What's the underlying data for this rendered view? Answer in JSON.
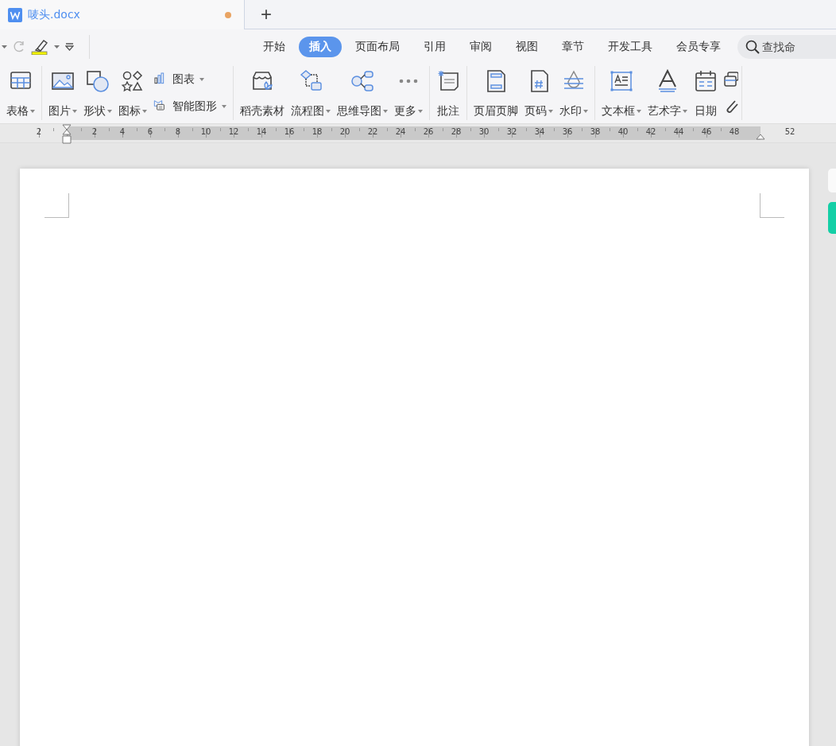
{
  "document_tab": {
    "title": "唛头.docx",
    "modified": true
  },
  "new_tab_button": "+",
  "menu_tabs": [
    {
      "label": "开始",
      "selected": false
    },
    {
      "label": "插入",
      "selected": true
    },
    {
      "label": "页面布局",
      "selected": false
    },
    {
      "label": "引用",
      "selected": false
    },
    {
      "label": "审阅",
      "selected": false
    },
    {
      "label": "视图",
      "selected": false
    },
    {
      "label": "章节",
      "selected": false
    },
    {
      "label": "开发工具",
      "selected": false
    },
    {
      "label": "会员专享",
      "selected": false
    }
  ],
  "search": {
    "placeholder": "查找命"
  },
  "ribbon_groups": [
    {
      "items": [
        {
          "kind": "large",
          "label": "表格",
          "dropdown": true
        }
      ]
    },
    {
      "items": [
        {
          "kind": "large",
          "label": "图片",
          "dropdown": true
        },
        {
          "kind": "large",
          "label": "形状",
          "dropdown": true
        },
        {
          "kind": "large",
          "label": "图标",
          "dropdown": true
        },
        {
          "kind": "small",
          "label": "图表",
          "dropdown": true
        },
        {
          "kind": "small",
          "label": "智能图形",
          "dropdown": true
        }
      ]
    },
    {
      "items": [
        {
          "kind": "large",
          "label": "稻壳素材",
          "dropdown": false
        },
        {
          "kind": "large",
          "label": "流程图",
          "dropdown": true
        },
        {
          "kind": "large",
          "label": "思维导图",
          "dropdown": true
        },
        {
          "kind": "large",
          "label": "更多",
          "dropdown": true
        }
      ]
    },
    {
      "items": [
        {
          "kind": "large",
          "label": "批注",
          "dropdown": false
        }
      ]
    },
    {
      "items": [
        {
          "kind": "large",
          "label": "页眉页脚",
          "dropdown": false
        },
        {
          "kind": "large",
          "label": "页码",
          "dropdown": true
        },
        {
          "kind": "large",
          "label": "水印",
          "dropdown": true
        }
      ]
    },
    {
      "items": [
        {
          "kind": "large",
          "label": "文本框",
          "dropdown": true
        },
        {
          "kind": "large",
          "label": "艺术字",
          "dropdown": true
        },
        {
          "kind": "large",
          "label": "日期",
          "dropdown": false
        }
      ]
    }
  ],
  "ruler": {
    "numbers": [
      "2",
      "2",
      "4",
      "6",
      "8",
      "10",
      "12",
      "14",
      "16",
      "18",
      "20",
      "22",
      "24",
      "26",
      "28",
      "30",
      "32",
      "34",
      "36",
      "38",
      "40",
      "42",
      "44",
      "46",
      "48",
      "52"
    ]
  }
}
